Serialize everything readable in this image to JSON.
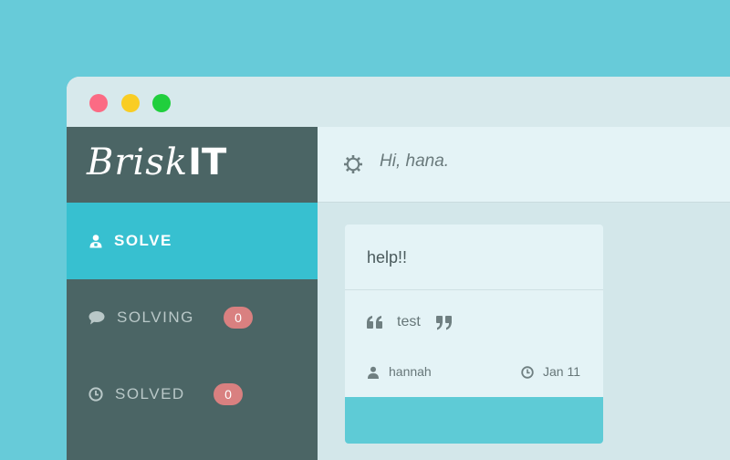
{
  "window": {
    "controls": [
      "close",
      "minimize",
      "maximize"
    ],
    "colors": {
      "close": "#fb6b84",
      "minimize": "#f9cd24",
      "maximize": "#20cf3d"
    }
  },
  "sidebar": {
    "logo": {
      "script": "Brisk",
      "bold": "IT"
    },
    "items": [
      {
        "label": "SOLVE",
        "icon": "user-icon",
        "active": true
      },
      {
        "label": "SOLVING",
        "icon": "comment-icon",
        "badge": "0"
      },
      {
        "label": "SOLVED",
        "icon": "clock-icon",
        "badge": "0"
      }
    ]
  },
  "header": {
    "greeting": "Hi, hana.",
    "icon": "gear-icon"
  },
  "card": {
    "title": "help!!",
    "quote": "test",
    "author": "hannah",
    "date": "Jan 11"
  },
  "colors": {
    "background": "#67cbd9",
    "sidebar": "#4b6565",
    "accent": "#37c0d0",
    "badge": "#d98080"
  }
}
